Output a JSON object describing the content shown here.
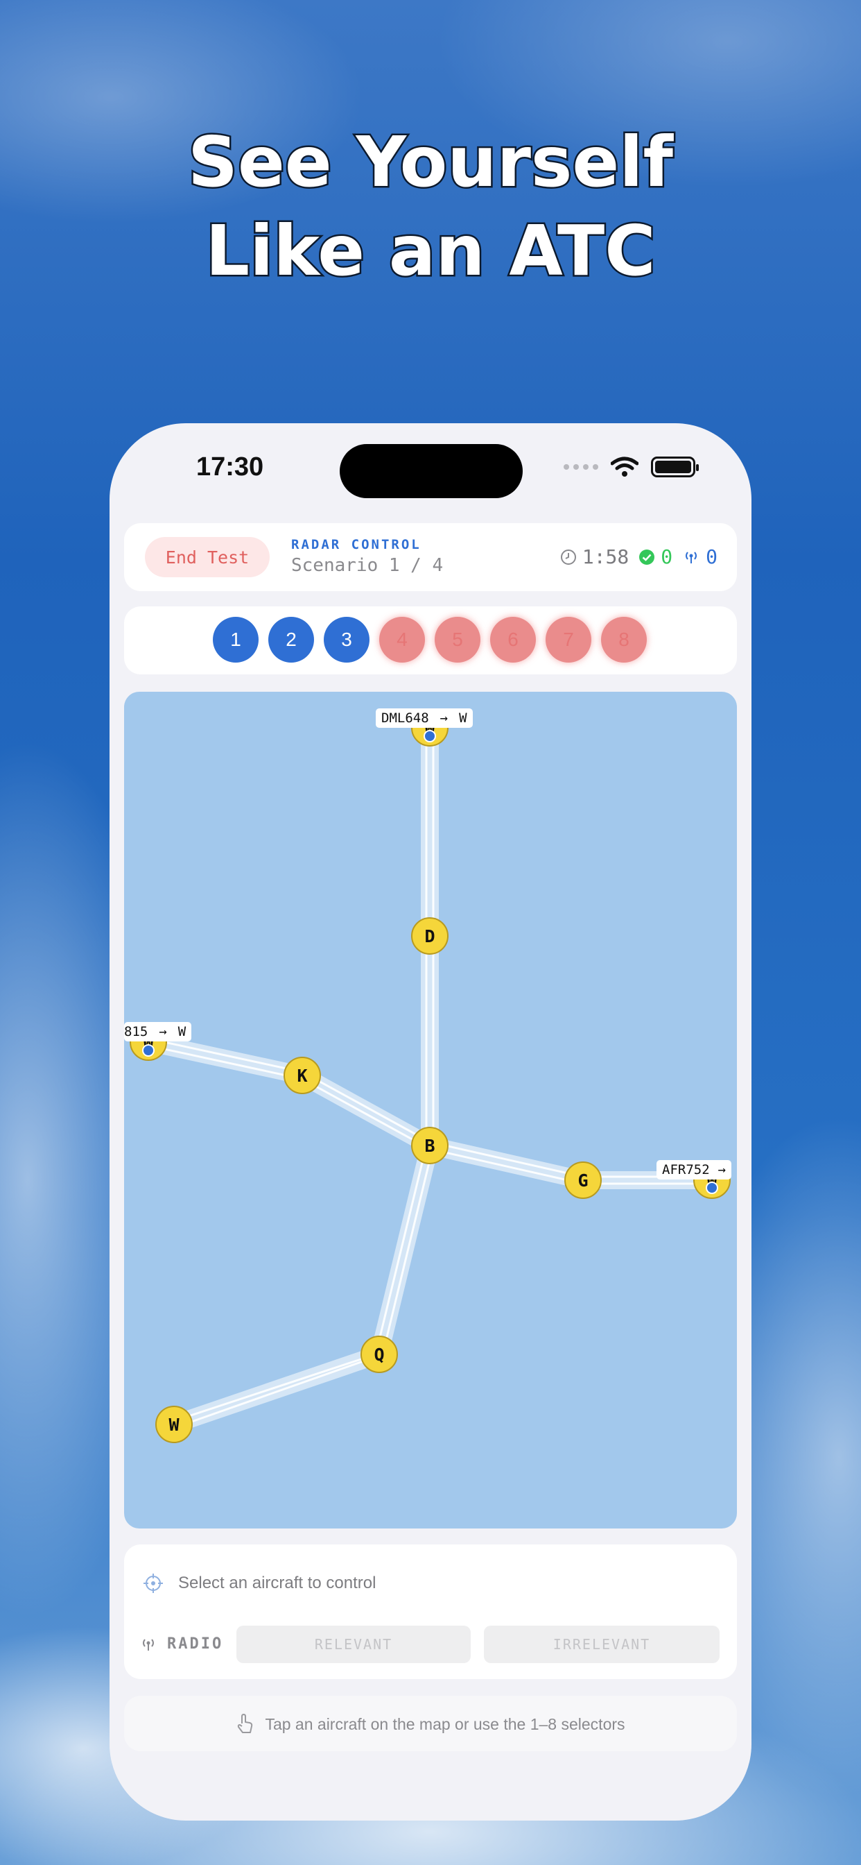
{
  "headline": {
    "line1": "See Yourself",
    "line2": "Like an ATC"
  },
  "status_bar": {
    "time": "17:30"
  },
  "top_card": {
    "end_button": "End Test",
    "mode_label": "RADAR CONTROL",
    "scenario": "Scenario 1 / 4",
    "timer": "1:58",
    "correct_count": "0",
    "radio_count": "0"
  },
  "selectors": [
    {
      "label": "1",
      "state": "active"
    },
    {
      "label": "2",
      "state": "active"
    },
    {
      "label": "3",
      "state": "active"
    },
    {
      "label": "4",
      "state": "inactive"
    },
    {
      "label": "5",
      "state": "inactive"
    },
    {
      "label": "6",
      "state": "inactive"
    },
    {
      "label": "7",
      "state": "inactive"
    },
    {
      "label": "8",
      "state": "inactive"
    }
  ],
  "map": {
    "fixes": {
      "D": "D",
      "K": "K",
      "B": "B",
      "G": "G",
      "Q": "Q",
      "W": "W"
    },
    "aircraft": [
      {
        "callsign": "DML648",
        "dest": "W"
      },
      {
        "callsign": "815",
        "dest": "W"
      },
      {
        "callsign": "AFR752",
        "dest": ""
      }
    ],
    "arrow": "→"
  },
  "control": {
    "hint": "Select an aircraft to control",
    "radio_label": "RADIO",
    "relevant": "RELEVANT",
    "irrelevant": "IRRELEVANT"
  },
  "tip": "Tap an aircraft on the map or use the 1–8 selectors",
  "colors": {
    "accent": "#2f6fd4",
    "danger": "#e0605e",
    "success": "#34c759",
    "fix": "#f5d63a",
    "map": "#a2c8ec"
  }
}
